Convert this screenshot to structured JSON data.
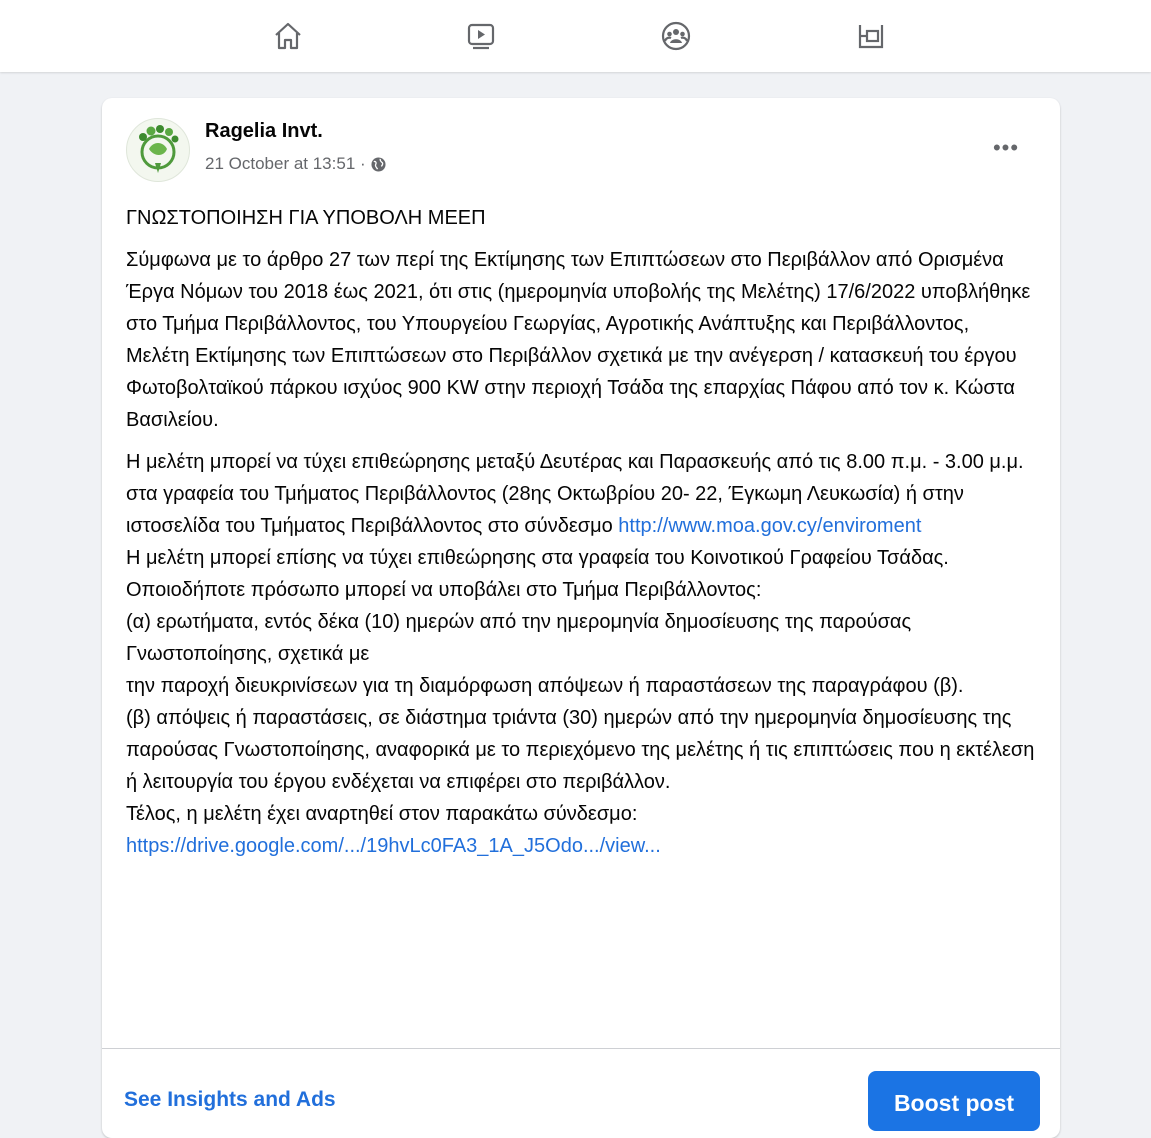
{
  "nav": {
    "icons": [
      "home-icon",
      "video-icon",
      "groups-icon",
      "gaming-icon"
    ]
  },
  "post": {
    "author": "Ragelia Invt.",
    "timestamp": "21 October at 13:51 ·",
    "title": "ΓΝΩΣΤΟΠΟΙΗΣΗ ΓΙΑ ΥΠΟΒΟΛΗ ΜΕΕΠ",
    "paragraph1": "Σύμφωνα με το άρθρο 27 των περί της Εκτίμησης των Επιπτώσεων στο Περιβάλλον από Ορισμένα Έργα Νόμων του 2018 έως 2021, ότι στις (ημερομηνία υποβολής της Μελέτης) 17/6/2022 υποβλήθηκε στο Τμήμα Περιβάλλοντος, του Υπουργείου Γεωργίας, Αγροτικής Ανάπτυξης και Περιβάλλοντος, Μελέτη Εκτίμησης των Επιπτώσεων στο Περιβάλλον σχετικά με την ανέγερση / κατασκευή του έργου Φωτοβολταϊκού πάρκου ισχύος 900 KW στην περιοχή Τσάδα της επαρχίας Πάφου από τον κ. Κώστα Βασιλείου.",
    "paragraph2_prefix": "Η μελέτη μπορεί να τύχει επιθεώρησης μεταξύ Δευτέρας και Παρασκευής από τις 8.00 π.μ. - 3.00 μ.μ. στα γραφεία του Τμήματος Περιβάλλοντος (28ης Οκτωβρίου 20- 22, Έγκωμη Λευκωσία) ή στην ιστοσελίδα του Τμήματος Περιβάλλοντος στο σύνδεσμο ",
    "link1": "http://www.moa.gov.cy/enviroment",
    "paragraph3": "Η μελέτη μπορεί επίσης να τύχει επιθεώρησης στα γραφεία του Κοινοτικού Γραφείου Τσάδας. Οποιοδήποτε πρόσωπο μπορεί να υποβάλει στο Τμήμα Περιβάλλοντος:",
    "item_a1": "(α) ερωτήματα, εντός δέκα (10) ημερών από την ημερομηνία δημοσίευσης της παρούσας Γνωστοποίησης, σχετικά με",
    "item_a2": "την παροχή διευκρινίσεων για τη διαμόρφωση απόψεων ή παραστάσεων της παραγράφου (β).",
    "item_b": "(β) απόψεις ή παραστάσεις, σε διάστημα τριάντα (30) ημερών από την ημερομηνία δημοσίευσης της παρούσας Γνωστοποίησης, αναφορικά με το περιεχόμενο της μελέτης ή τις επιπτώσεις που η εκτέλεση ή λειτουργία του έργου ενδέχεται να επιφέρει στο περιβάλλον.",
    "closing": "Τέλος, η μελέτη έχει αναρτηθεί στον παρακάτω σύνδεσμο:",
    "link2": "https://drive.google.com/.../19hvLc0FA3_1A_J5Odo.../view..."
  },
  "footer": {
    "insights_label": "See Insights and Ads",
    "boost_label": "Boost post"
  },
  "colors": {
    "link": "#216fdb",
    "boost_bg": "#1b74e4",
    "page_bg": "#f0f2f5"
  }
}
